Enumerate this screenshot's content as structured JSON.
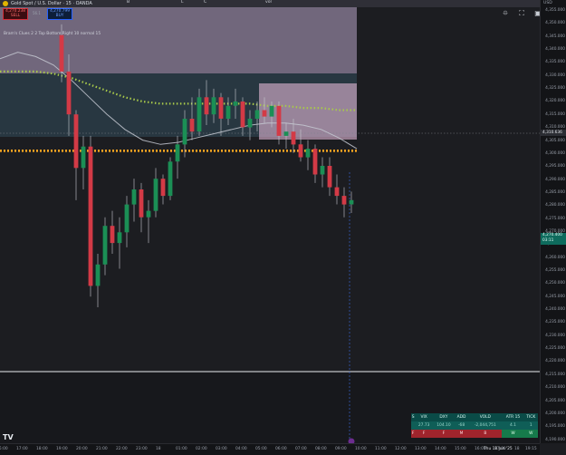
{
  "header": {
    "symbol": "Gold Spot / U.S. Dollar · 15 · OANDA",
    "tabs": [
      "B",
      "L",
      "C",
      "vol"
    ],
    "sell_price": "4,270.238",
    "sell_label": "SELL",
    "buy_price": "4,270.799",
    "buy_label": "BUY",
    "spread": "56.1",
    "indicator": "Bram's Clues 2 2 Top Bottom Right 10 normal 15"
  },
  "toolbar": {
    "icons": [
      "expand-icon",
      "fullscreen-icon",
      "camera-icon"
    ]
  },
  "price_axis": {
    "currency": "USD",
    "ticks": [
      "4,355.000",
      "4,350.000",
      "4,345.000",
      "4,340.000",
      "4,335.000",
      "4,330.000",
      "4,325.000",
      "4,320.000",
      "4,315.000",
      "4,310.000",
      "4,305.000",
      "4,300.000",
      "4,295.000",
      "4,290.000",
      "4,285.000",
      "4,280.000",
      "4,275.000",
      "4,270.000",
      "4,265.000",
      "4,260.000",
      "4,255.000",
      "4,250.000",
      "4,245.000",
      "4,240.000",
      "4,235.000",
      "4,230.000",
      "4,225.000",
      "4,220.000",
      "4,215.000",
      "4,210.000",
      "4,205.000",
      "4,200.000",
      "4,195.000",
      "4,190.000"
    ],
    "crosshair_price": "4,310.636",
    "last_price": "4,270.400",
    "countdown": "03:11"
  },
  "time_axis": {
    "ticks": [
      "16:00",
      "17:00",
      "18:00",
      "19:00",
      "20:00",
      "21:00",
      "22:00",
      "23:00",
      "18",
      "01:00",
      "02:00",
      "03:00",
      "04:00",
      "05:00",
      "06:00",
      "07:00",
      "08:00",
      "09:00",
      "10:00",
      "11:00",
      "12:00",
      "13:00",
      "14:00",
      "15:00",
      "16:00",
      "17:00",
      "18"
    ],
    "current": "Thu 18 Jun '25",
    "end": "19:15"
  },
  "stats": {
    "headers": [
      "S",
      "VIX",
      "DXY",
      "ADD",
      "VOLD",
      "ATR 15",
      "TICK"
    ],
    "values": [
      "27.73",
      "104.10",
      "-68",
      "-2,044,751",
      "4.1",
      "1"
    ],
    "signals": [
      "F",
      "F",
      "F",
      "M",
      "B",
      "W",
      "W"
    ]
  },
  "chart_data": {
    "type": "candlestick",
    "x": [
      "16:00",
      "17:00",
      "18:00",
      "19:00",
      "20:00",
      "21:00",
      "22:00",
      "23:00",
      "18",
      "01:00",
      "02:00",
      "03:00",
      "04:00",
      "05:00",
      "06:00",
      "07:00",
      "08:00",
      "09:00",
      "10:00",
      "11:00"
    ],
    "ylim": [
      4190,
      4360
    ],
    "colors": {
      "up": "#1b8f55",
      "down": "#d33a46",
      "ma_white": "#c5c9d2",
      "ma_green": "#a8c94a",
      "ma_orange": "#f0a020"
    },
    "candles": [
      [
        4347,
        4352,
        4325,
        4330
      ],
      [
        4330,
        4338,
        4300,
        4310
      ],
      [
        4310,
        4312,
        4270,
        4285
      ],
      [
        4285,
        4300,
        4275,
        4295
      ],
      [
        4295,
        4300,
        4225,
        4230
      ],
      [
        4230,
        4245,
        4220,
        4240
      ],
      [
        4240,
        4262,
        4235,
        4258
      ],
      [
        4258,
        4265,
        4245,
        4250
      ],
      [
        4250,
        4262,
        4238,
        4255
      ],
      [
        4255,
        4272,
        4248,
        4268
      ],
      [
        4268,
        4280,
        4260,
        4275
      ],
      [
        4275,
        4278,
        4255,
        4262
      ],
      [
        4262,
        4270,
        4250,
        4265
      ],
      [
        4265,
        4285,
        4262,
        4280
      ],
      [
        4280,
        4282,
        4268,
        4272
      ],
      [
        4272,
        4290,
        4270,
        4288
      ],
      [
        4288,
        4300,
        4280,
        4296
      ],
      [
        4296,
        4312,
        4290,
        4308
      ],
      [
        4308,
        4318,
        4298,
        4302
      ],
      [
        4302,
        4322,
        4300,
        4318
      ],
      [
        4318,
        4326,
        4305,
        4310
      ],
      [
        4310,
        4322,
        4306,
        4318
      ],
      [
        4318,
        4320,
        4300,
        4308
      ],
      [
        4308,
        4318,
        4305,
        4314
      ],
      [
        4314,
        4322,
        4308,
        4316
      ],
      [
        4316,
        4318,
        4300,
        4304
      ],
      [
        4304,
        4312,
        4298,
        4308
      ],
      [
        4308,
        4316,
        4302,
        4312
      ],
      [
        4312,
        4318,
        4306,
        4309
      ],
      [
        4309,
        4316,
        4304,
        4314
      ],
      [
        4314,
        4316,
        4296,
        4300
      ],
      [
        4300,
        4306,
        4294,
        4302
      ],
      [
        4302,
        4308,
        4292,
        4296
      ],
      [
        4296,
        4303,
        4288,
        4290
      ],
      [
        4290,
        4298,
        4284,
        4294
      ],
      [
        4294,
        4296,
        4278,
        4282
      ],
      [
        4282,
        4290,
        4276,
        4286
      ],
      [
        4286,
        4290,
        4272,
        4276
      ],
      [
        4276,
        4282,
        4268,
        4272
      ],
      [
        4272,
        4276,
        4262,
        4268
      ],
      [
        4268,
        4274,
        4264,
        4270
      ]
    ],
    "moving_averages": [
      {
        "name": "",
        "values": [
          4336,
          4339,
          4337,
          4333,
          4326,
          4318,
          4310,
          4303,
          4298,
          4296,
          4297,
          4299,
          4301,
          4303,
          4305,
          4306,
          4306,
          4305,
          4303,
          4299,
          4294
        ]
      },
      {
        "name": "",
        "values": [
          4330,
          4330,
          4330,
          4329,
          4327,
          4324,
          4321,
          4318,
          4316,
          4315,
          4315,
          4315,
          4315,
          4315,
          4315,
          4314,
          4314,
          4313,
          4313,
          4312,
          4312
        ]
      },
      {
        "name": "",
        "values": [
          4293,
          4293,
          4293,
          4293,
          4293,
          4293,
          4293,
          4293,
          4293,
          4293,
          4293,
          4293,
          4293,
          4293,
          4293,
          4293,
          4293,
          4293,
          4293,
          4293,
          4293
        ]
      }
    ]
  }
}
